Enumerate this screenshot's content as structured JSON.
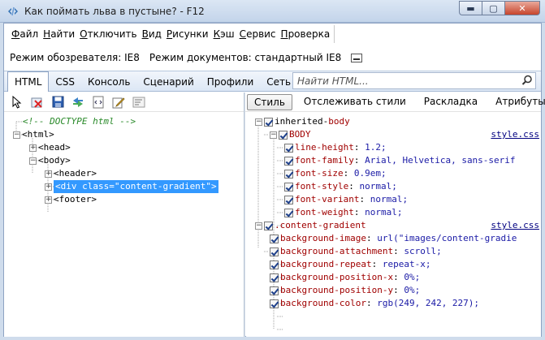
{
  "window": {
    "title": "Как поймать льва в пустыне? - F12",
    "min_label": "▬",
    "max_label": "▢",
    "close_label": "✕"
  },
  "menu": {
    "items": [
      {
        "pre": "",
        "u": "Ф",
        "post": "айл"
      },
      {
        "pre": "",
        "u": "Н",
        "post": "айти"
      },
      {
        "pre": "",
        "u": "О",
        "post": "тключить"
      },
      {
        "pre": "",
        "u": "В",
        "post": "ид"
      },
      {
        "pre": "",
        "u": "Р",
        "post": "исунки"
      },
      {
        "pre": "",
        "u": "К",
        "post": "эш"
      },
      {
        "pre": "",
        "u": "С",
        "post": "ервис"
      },
      {
        "pre": "",
        "u": "П",
        "post": "роверка"
      }
    ]
  },
  "modebar": {
    "browser_mode": "Режим обозревателя: IE8",
    "document_mode": "Режим документов: стандартный IE8"
  },
  "tabs": [
    {
      "label": "HTML",
      "active": true
    },
    {
      "label": "CSS"
    },
    {
      "label": "Консоль"
    },
    {
      "label": "Сценарий"
    },
    {
      "label": "Профили"
    },
    {
      "label": "Сеть"
    }
  ],
  "search": {
    "placeholder": "Найти HTML..."
  },
  "right_tabs": [
    {
      "label": "Стиль",
      "active": true
    },
    {
      "label": "Отслеживать стили"
    },
    {
      "label": "Раскладка"
    },
    {
      "label": "Атрибуты"
    }
  ],
  "tree": [
    {
      "text": "<!-- DOCTYPE html -->",
      "comment": true
    },
    {
      "text": "<html>"
    },
    {
      "text": "<head>"
    },
    {
      "text": "<body>"
    },
    {
      "text": "<header>"
    },
    {
      "text": "<div class=\"content-gradient\">",
      "selected": true
    },
    {
      "text": "<footer>"
    }
  ],
  "styles": {
    "inherited_label": "inherited",
    "inherited_sep": " - ",
    "inherited_from": "body",
    "body_rule": "BODY",
    "body_source": "style.css",
    "body_props": [
      {
        "name": "line-height",
        "value": "1.2;"
      },
      {
        "name": "font-family",
        "value": "Arial, Helvetica, sans-serif"
      },
      {
        "name": "font-size",
        "value": "0.9em;"
      },
      {
        "name": "font-style",
        "value": "normal;"
      },
      {
        "name": "font-variant",
        "value": "normal;"
      },
      {
        "name": "font-weight",
        "value": "normal;"
      }
    ],
    "cg_rule": ".content-gradient",
    "cg_source": "style.css",
    "cg_props": [
      {
        "name": "background-image",
        "value": "url(\"images/content-gradie"
      },
      {
        "name": "background-attachment",
        "value": "scroll;"
      },
      {
        "name": "background-repeat",
        "value": "repeat-x;"
      },
      {
        "name": "background-position-x",
        "value": "0%;"
      },
      {
        "name": "background-position-y",
        "value": "0%;"
      },
      {
        "name": "background-color",
        "value": "rgb(249, 242, 227);"
      }
    ]
  }
}
